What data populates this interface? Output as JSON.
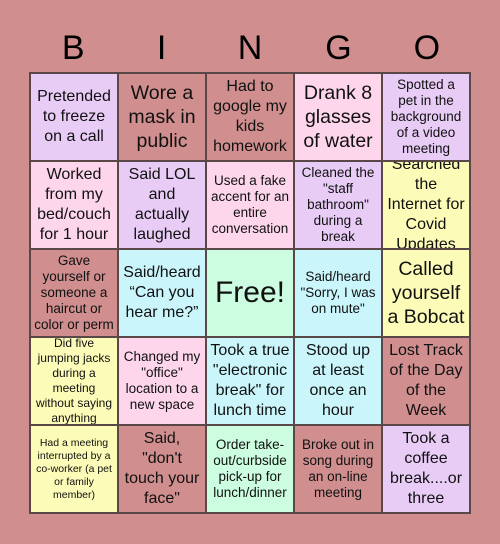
{
  "title_letters": [
    "B",
    "I",
    "N",
    "G",
    "O"
  ],
  "colors": {
    "background": "#d08e8e",
    "lavender": "#e8ccf6",
    "pink": "#fdd6ec",
    "rose": "#d08e8e",
    "cyan": "#c9f5fb",
    "mint": "#ccfde0",
    "yellow": "#fdfbb8"
  },
  "cells": [
    {
      "text": "Pretended to freeze on a call",
      "color": "#e8ccf6",
      "size": "fs-l"
    },
    {
      "text": "Wore a mask in public",
      "color": "#d08e8e",
      "size": "fs-xl"
    },
    {
      "text": "Had to google my kids homework",
      "color": "#d08e8e",
      "size": "fs-l"
    },
    {
      "text": "Drank 8 glasses of water",
      "color": "#fdd6ec",
      "size": "fs-xl"
    },
    {
      "text": "Spotted a pet in the background of a video meeting",
      "color": "#e8ccf6",
      "size": "fs-m"
    },
    {
      "text": "Worked from my bed/couch for 1 hour",
      "color": "#fdd6ec",
      "size": "fs-l"
    },
    {
      "text": "Said LOL and actually laughed",
      "color": "#e8ccf6",
      "size": "fs-l"
    },
    {
      "text": "Used a fake accent for an entire conversation",
      "color": "#fdd6ec",
      "size": "fs-m"
    },
    {
      "text": "Cleaned the \"staff bathroom\" during a break",
      "color": "#e8ccf6",
      "size": "fs-m"
    },
    {
      "text": "Searched the Internet for Covid Updates",
      "color": "#fdfbb8",
      "size": "fs-l"
    },
    {
      "text": "Gave yourself or someone a haircut or color or perm",
      "color": "#d08e8e",
      "size": "fs-m"
    },
    {
      "text": "Said/heard “Can you hear me?”",
      "color": "#c9f5fb",
      "size": "fs-l"
    },
    {
      "text": "Free!",
      "color": "#ccfde0",
      "size": "fs-free"
    },
    {
      "text": "Said/heard \"Sorry, I was on mute\"",
      "color": "#c9f5fb",
      "size": "fs-m"
    },
    {
      "text": "Called yourself a Bobcat",
      "color": "#fdfbb8",
      "size": "fs-xl"
    },
    {
      "text": "Did five jumping jacks during a meeting without saying anything",
      "color": "#fdfbb8",
      "size": "fs-s"
    },
    {
      "text": "Changed my \"office\" location to a new space",
      "color": "#fdd6ec",
      "size": "fs-m"
    },
    {
      "text": "Took a true \"electronic break\" for lunch time",
      "color": "#c9f5fb",
      "size": "fs-l"
    },
    {
      "text": "Stood up at least once an hour",
      "color": "#c9f5fb",
      "size": "fs-l"
    },
    {
      "text": "Lost Track of the Day of the Week",
      "color": "#d08e8e",
      "size": "fs-l"
    },
    {
      "text": "Had a meeting interrupted by a co-worker (a pet or family member)",
      "color": "#fdfbb8",
      "size": "fs-xs"
    },
    {
      "text": "Said, \"don't touch your face\"",
      "color": "#d08e8e",
      "size": "fs-l"
    },
    {
      "text": "Order take-out/curbside pick-up for lunch/dinner",
      "color": "#ccfde0",
      "size": "fs-m"
    },
    {
      "text": "Broke out in song during an on-line meeting",
      "color": "#d08e8e",
      "size": "fs-m"
    },
    {
      "text": "Took a coffee break....or three",
      "color": "#e8ccf6",
      "size": "fs-l"
    }
  ]
}
